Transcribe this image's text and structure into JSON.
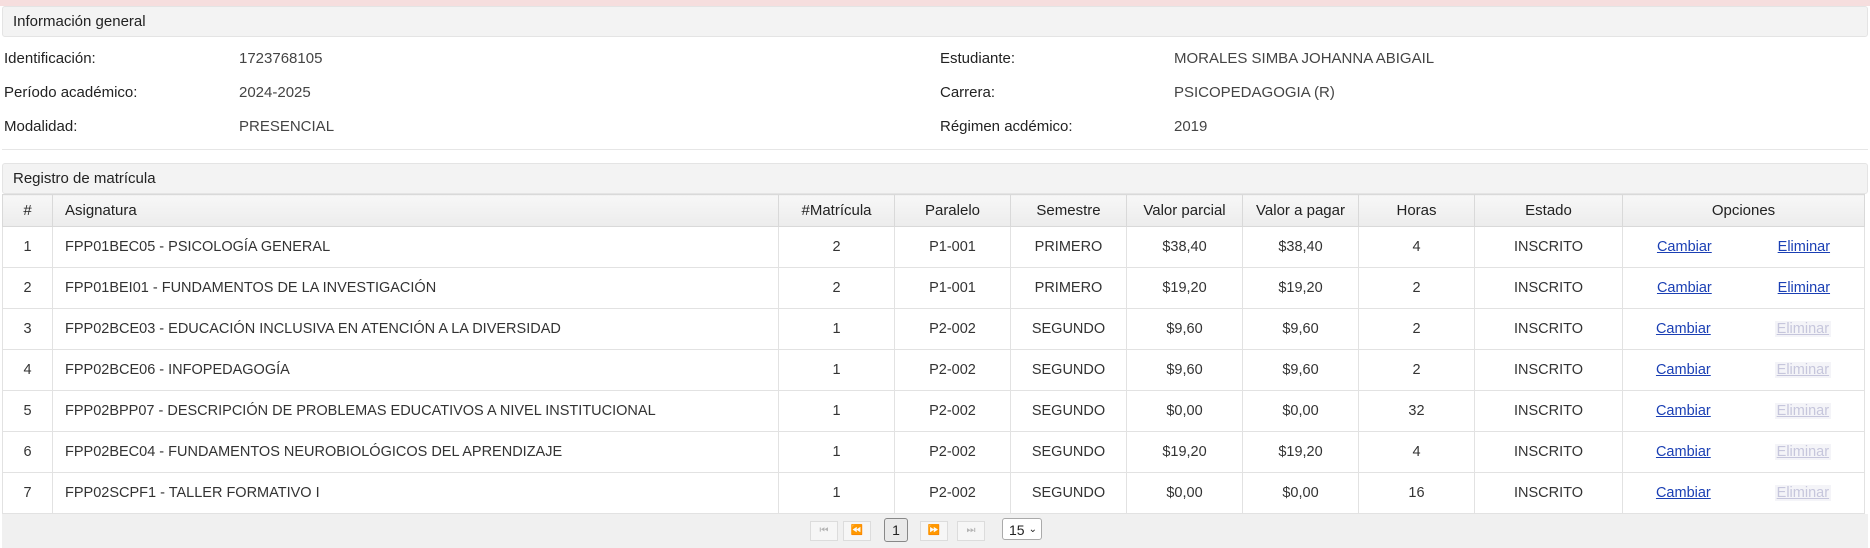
{
  "info": {
    "title": "Información general",
    "identificacion_label": "Identificación:",
    "identificacion_value": "1723768105",
    "periodo_label": "Período académico:",
    "periodo_value": "2024-2025",
    "modalidad_label": "Modalidad:",
    "modalidad_value": "PRESENCIAL",
    "estudiante_label": "Estudiante:",
    "estudiante_value": "MORALES SIMBA JOHANNA ABIGAIL",
    "carrera_label": "Carrera:",
    "carrera_value": "PSICOPEDAGOGIA (R)",
    "regimen_label": "Régimen acdémico:",
    "regimen_value": "2019"
  },
  "registro": {
    "title": "Registro de matrícula",
    "columns": [
      "#",
      "Asignatura",
      "#Matrícula",
      "Paralelo",
      "Semestre",
      "Valor parcial",
      "Valor a pagar",
      "Horas",
      "Estado",
      "Opciones"
    ],
    "change_label": "Cambiar",
    "delete_label": "Eliminar",
    "rows": [
      {
        "n": "1",
        "asignatura": "FPP01BEC05 - PSICOLOGÍA GENERAL",
        "matricula": "2",
        "paralelo": "P1-001",
        "semestre": "PRIMERO",
        "parcial": "$38,40",
        "pagar": "$38,40",
        "horas": "4",
        "estado": "INSCRITO",
        "delete_enabled": true
      },
      {
        "n": "2",
        "asignatura": "FPP01BEI01 - FUNDAMENTOS DE LA INVESTIGACIÓN",
        "matricula": "2",
        "paralelo": "P1-001",
        "semestre": "PRIMERO",
        "parcial": "$19,20",
        "pagar": "$19,20",
        "horas": "2",
        "estado": "INSCRITO",
        "delete_enabled": true
      },
      {
        "n": "3",
        "asignatura": "FPP02BCE03 - EDUCACIÓN INCLUSIVA EN ATENCIÓN A LA DIVERSIDAD",
        "matricula": "1",
        "paralelo": "P2-002",
        "semestre": "SEGUNDO",
        "parcial": "$9,60",
        "pagar": "$9,60",
        "horas": "2",
        "estado": "INSCRITO",
        "delete_enabled": false
      },
      {
        "n": "4",
        "asignatura": "FPP02BCE06 - INFOPEDAGOGÍA",
        "matricula": "1",
        "paralelo": "P2-002",
        "semestre": "SEGUNDO",
        "parcial": "$9,60",
        "pagar": "$9,60",
        "horas": "2",
        "estado": "INSCRITO",
        "delete_enabled": false
      },
      {
        "n": "5",
        "asignatura": "FPP02BPP07 - DESCRIPCIÓN DE PROBLEMAS EDUCATIVOS A NIVEL INSTITUCIONAL",
        "matricula": "1",
        "paralelo": "P2-002",
        "semestre": "SEGUNDO",
        "parcial": "$0,00",
        "pagar": "$0,00",
        "horas": "32",
        "estado": "INSCRITO",
        "delete_enabled": false
      },
      {
        "n": "6",
        "asignatura": "FPP02BEC04 - FUNDAMENTOS NEUROBIOLÓGICOS DEL APRENDIZAJE",
        "matricula": "1",
        "paralelo": "P2-002",
        "semestre": "SEGUNDO",
        "parcial": "$19,20",
        "pagar": "$19,20",
        "horas": "4",
        "estado": "INSCRITO",
        "delete_enabled": false
      },
      {
        "n": "7",
        "asignatura": "FPP02SCPF1 - TALLER FORMATIVO I",
        "matricula": "1",
        "paralelo": "P2-002",
        "semestre": "SEGUNDO",
        "parcial": "$0,00",
        "pagar": "$0,00",
        "horas": "16",
        "estado": "INSCRITO",
        "delete_enabled": false
      }
    ]
  },
  "pager": {
    "first_glyph": "⏮",
    "prev_glyph": "⏪",
    "next_glyph": "⏩",
    "last_glyph": "⏭",
    "current_page": "1",
    "page_size": "15",
    "chevron": "⌄"
  }
}
